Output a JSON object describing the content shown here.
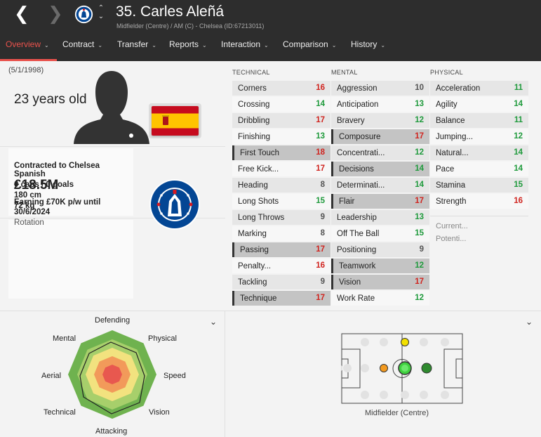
{
  "header": {
    "back_icon": "chevron-left-icon",
    "forward_icon": "chevron-right-icon",
    "title": "35. Carles Aleñá",
    "subtitle": "Midfielder (Centre) / AM (C) - Chelsea (ID:67213011)",
    "up_glyph": "⌃",
    "down_glyph": "⌄"
  },
  "tabs": [
    {
      "label": "Overview",
      "active": true
    },
    {
      "label": "Contract"
    },
    {
      "label": "Transfer"
    },
    {
      "label": "Reports"
    },
    {
      "label": "Interaction"
    },
    {
      "label": "Comparison"
    },
    {
      "label": "History"
    }
  ],
  "profile": {
    "dob": "(5/1/1998)",
    "age": "23 years old",
    "nationality": "Spanish",
    "caps": "0 caps / 0 goals",
    "height": "180 cm",
    "weight": "72 kg",
    "contract_club": "Contracted to Chelsea",
    "value": "£18.5M",
    "wage": "Earning £70K p/w until 30/6/2024",
    "squad_status": "Rotation"
  },
  "columns": {
    "technical": "TECHNICAL",
    "mental": "MENTAL",
    "physical": "PHYSICAL"
  },
  "technical": [
    {
      "name": "Corners",
      "value": "16",
      "color": "red"
    },
    {
      "name": "Crossing",
      "value": "14",
      "color": "green"
    },
    {
      "name": "Dribbling",
      "value": "17",
      "color": "red"
    },
    {
      "name": "Finishing",
      "value": "13",
      "color": "green"
    },
    {
      "name": "First Touch",
      "value": "18",
      "color": "red",
      "highlight": true
    },
    {
      "name": "Free Kick...",
      "value": "17",
      "color": "red"
    },
    {
      "name": "Heading",
      "value": "8",
      "color": "grey"
    },
    {
      "name": "Long Shots",
      "value": "15",
      "color": "green"
    },
    {
      "name": "Long Throws",
      "value": "9",
      "color": "grey"
    },
    {
      "name": "Marking",
      "value": "8",
      "color": "grey"
    },
    {
      "name": "Passing",
      "value": "17",
      "color": "red",
      "highlight": true
    },
    {
      "name": "Penalty...",
      "value": "16",
      "color": "red"
    },
    {
      "name": "Tackling",
      "value": "9",
      "color": "grey"
    },
    {
      "name": "Technique",
      "value": "17",
      "color": "red",
      "highlight": true
    }
  ],
  "mental": [
    {
      "name": "Aggression",
      "value": "10",
      "color": "grey"
    },
    {
      "name": "Anticipation",
      "value": "13",
      "color": "green"
    },
    {
      "name": "Bravery",
      "value": "12",
      "color": "green"
    },
    {
      "name": "Composure",
      "value": "17",
      "color": "red",
      "highlight": true
    },
    {
      "name": "Concentrati...",
      "value": "12",
      "color": "green"
    },
    {
      "name": "Decisions",
      "value": "14",
      "color": "green",
      "highlight": true
    },
    {
      "name": "Determinati...",
      "value": "14",
      "color": "green"
    },
    {
      "name": "Flair",
      "value": "17",
      "color": "red",
      "highlight": true
    },
    {
      "name": "Leadership",
      "value": "13",
      "color": "green"
    },
    {
      "name": "Off The Ball",
      "value": "15",
      "color": "green"
    },
    {
      "name": "Positioning",
      "value": "9",
      "color": "grey"
    },
    {
      "name": "Teamwork",
      "value": "12",
      "color": "green",
      "highlight": true
    },
    {
      "name": "Vision",
      "value": "17",
      "color": "red",
      "highlight": true
    },
    {
      "name": "Work Rate",
      "value": "12",
      "color": "green"
    }
  ],
  "physical": [
    {
      "name": "Acceleration",
      "value": "11",
      "color": "green"
    },
    {
      "name": "Agility",
      "value": "14",
      "color": "green"
    },
    {
      "name": "Balance",
      "value": "11",
      "color": "green"
    },
    {
      "name": "Jumping...",
      "value": "12",
      "color": "green"
    },
    {
      "name": "Natural...",
      "value": "14",
      "color": "green"
    },
    {
      "name": "Pace",
      "value": "14",
      "color": "green"
    },
    {
      "name": "Stamina",
      "value": "15",
      "color": "green"
    },
    {
      "name": "Strength",
      "value": "16",
      "color": "red"
    }
  ],
  "ability": {
    "current": "Current...",
    "potential": "Potenti..."
  },
  "radar": {
    "labels": [
      "Defending",
      "Physical",
      "Speed",
      "Vision",
      "Attacking",
      "Technical",
      "Aerial",
      "Mental"
    ]
  },
  "positions": {
    "label": "Midfielder (Centre)"
  },
  "colors": {
    "accent": "#e9524c",
    "good": "#1f9a3c",
    "great": "#d0241f",
    "topbar": "#2d2d2d",
    "radar_outer": "#6fb24f",
    "radar_inner": "#e8584f"
  }
}
